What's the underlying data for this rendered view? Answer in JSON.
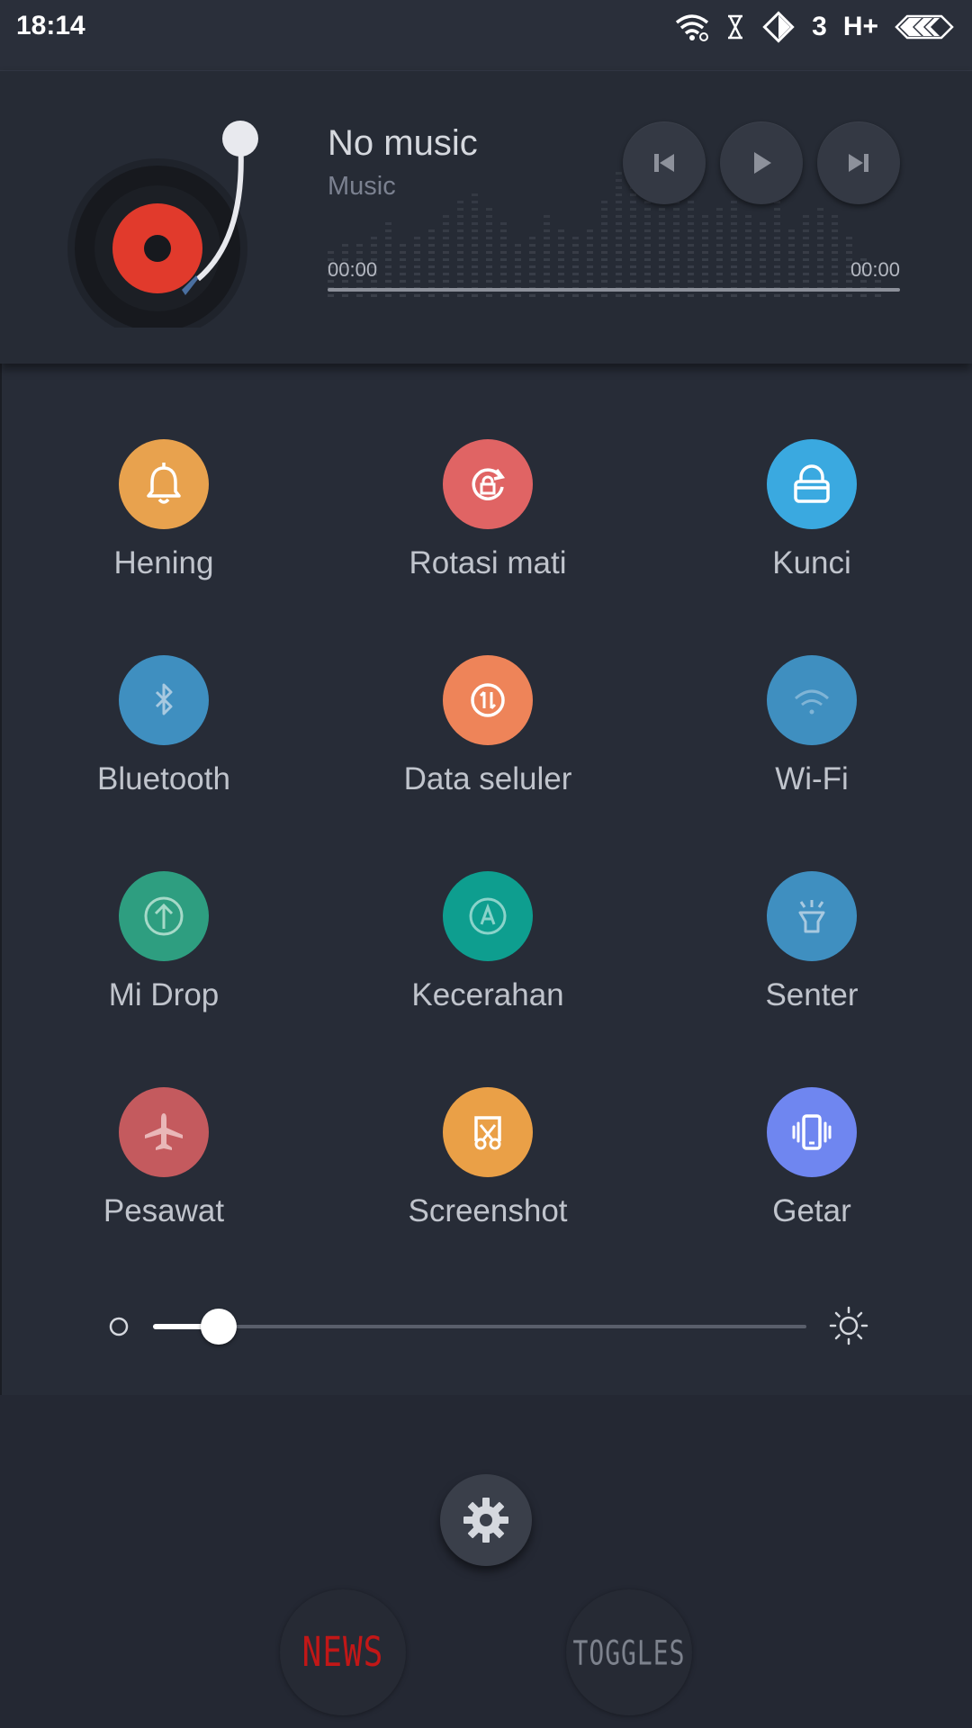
{
  "status_bar": {
    "time": "18:14",
    "network": "3",
    "network_type": "H+",
    "icons": [
      "wifi-icon",
      "hourglass-icon",
      "diamond-signal-icon",
      "battery-icon"
    ]
  },
  "music": {
    "title": "No music",
    "subtitle": "Music",
    "time_elapsed": "00:00",
    "time_total": "00:00",
    "progress": 0,
    "controls": [
      "previous-icon",
      "play-icon",
      "next-icon"
    ]
  },
  "toggles": [
    {
      "label": "Hening",
      "icon": "bell-icon",
      "color": "#E8A24E"
    },
    {
      "label": "Rotasi mati",
      "icon": "rotation-lock-icon",
      "color": "#E06464"
    },
    {
      "label": "Kunci",
      "icon": "lock-icon",
      "color": "#3AA9E0"
    },
    {
      "label": "Bluetooth",
      "icon": "bluetooth-icon",
      "color": "#3F8FC0"
    },
    {
      "label": "Data seluler",
      "icon": "mobile-data-icon",
      "color": "#EE8459"
    },
    {
      "label": "Wi-Fi",
      "icon": "wifi-icon",
      "color": "#3F8FC0"
    },
    {
      "label": "Mi Drop",
      "icon": "mi-drop-icon",
      "color": "#2E9E80"
    },
    {
      "label": "Kecerahan",
      "icon": "auto-brightness-icon",
      "color": "#0E9E8F"
    },
    {
      "label": "Senter",
      "icon": "flashlight-icon",
      "color": "#3F8FC0"
    },
    {
      "label": "Pesawat",
      "icon": "airplane-icon",
      "color": "#C45A5E"
    },
    {
      "label": "Screenshot",
      "icon": "screenshot-icon",
      "color": "#EAA047"
    },
    {
      "label": "Getar",
      "icon": "vibrate-icon",
      "color": "#6F86F0"
    }
  ],
  "brightness": {
    "level": 0.1
  },
  "bottom": {
    "settings_icon": "gear-icon",
    "news_label": "NEWS",
    "toggles_label": "TOGGLES"
  }
}
